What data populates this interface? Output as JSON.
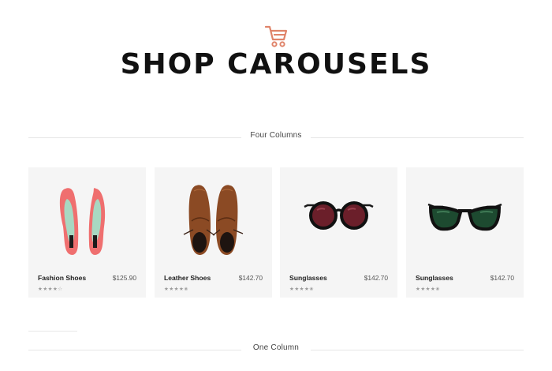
{
  "header": {
    "icon": "shopping-cart-icon",
    "title": "SHOP CAROUSELS",
    "accent_color": "#e0846a"
  },
  "sections": [
    {
      "label": "Four Columns"
    },
    {
      "label": "One Column"
    }
  ],
  "products": [
    {
      "name": "Fashion Shoes",
      "price": "$125.90",
      "rating": 4,
      "rating_display": "★★★★☆",
      "image": "pink-heels-image"
    },
    {
      "name": "Leather Shoes",
      "price": "$142.70",
      "rating": 4.5,
      "rating_display": "★★★★✬",
      "image": "brown-brogues-image"
    },
    {
      "name": "Sunglasses",
      "price": "$142.70",
      "rating": 4.5,
      "rating_display": "★★★★✬",
      "image": "red-sunglasses-image"
    },
    {
      "name": "Sunglasses",
      "price": "$142.70",
      "rating": 4.5,
      "rating_display": "★★★★✬",
      "image": "green-sunglasses-image"
    }
  ]
}
